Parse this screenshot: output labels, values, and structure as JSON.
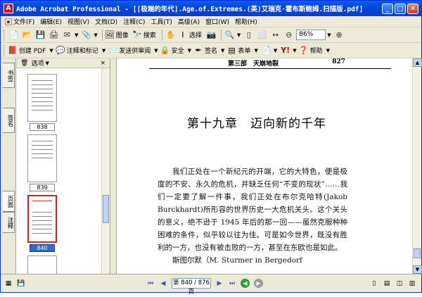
{
  "window": {
    "title": "Adobe Acrobat Professional - [[极端的年代].Age.of.Extremes.(英)艾瑞克·霍布斯鲍姆.扫描版.pdf]",
    "app_icon": "A"
  },
  "menu": [
    {
      "label": "文件(F)"
    },
    {
      "label": "编辑(E)"
    },
    {
      "label": "视图(V)"
    },
    {
      "label": "文档(D)"
    },
    {
      "label": "注释(C)"
    },
    {
      "label": "工具(T)"
    },
    {
      "label": "高级(A)"
    },
    {
      "label": "窗口(W)"
    },
    {
      "label": "帮助(H)"
    }
  ],
  "toolbar1": {
    "image_button": "图像",
    "search_button": "搜索",
    "select_button": "选择",
    "zoom_value": "86%"
  },
  "toolbar2": {
    "create_pdf": "创建 PDF",
    "review": "注释和标记",
    "send_review": "发送供审阅",
    "secure": "安全",
    "sign": "签名",
    "forms": "表单",
    "help": "帮助"
  },
  "side_tabs": {
    "bookmarks": "书签",
    "signatures": "签名",
    "pages": "页面",
    "comments": "注释"
  },
  "pages_panel": {
    "options": "选项",
    "thumbnails": [
      {
        "label": "838"
      },
      {
        "label": "839"
      },
      {
        "label": "840"
      }
    ]
  },
  "document": {
    "running_head": "第三部　天崩地裂",
    "page_number": "827",
    "chapter_title": "第十九章　迈向新的千年",
    "paragraphs": [
      "我们正处在一个新纪元的开端，它的大特色，便是极度的不安、永久的危机，并缺乏任何“不变的现状”……我们一定要了解一件事，我们正处在布尔克哈特(Jakob Burckhardt)所形容的世界历史一大危机关头。这个关头的意义，绝不逊于 1945 年后的那一回——虽然克服种种困难的条件，似乎较以往为佳。可是如今世界，既没有胜利的一方，也没有被击败的一方，甚至在东欧也是如此。",
      "斯图尔默（M. Sturmer in Bergedorf"
    ]
  },
  "statusbar": {
    "page_indicator": "第 840 / 876 页"
  }
}
